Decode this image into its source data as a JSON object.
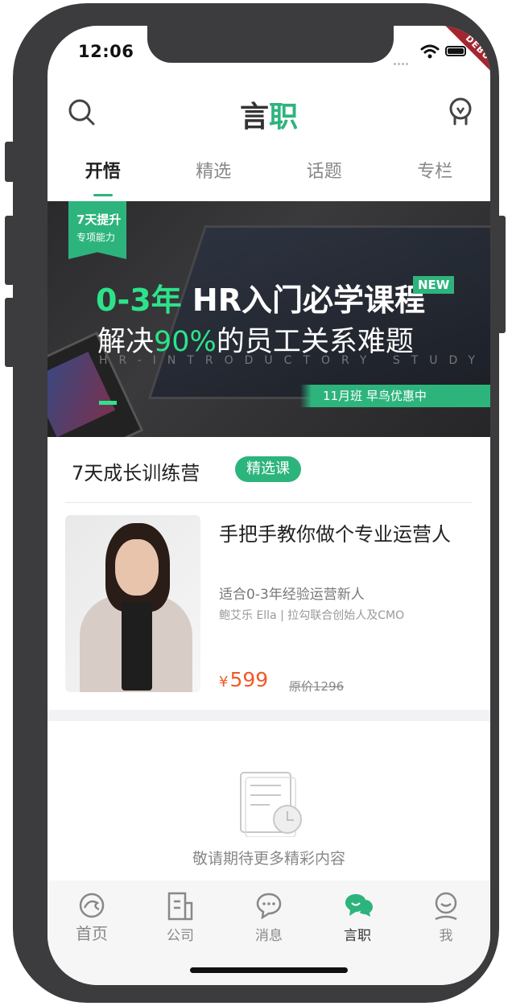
{
  "status_bar": {
    "time": "12:06",
    "debug_label": "DEBUG"
  },
  "header": {
    "title_part1": "言",
    "title_part2": "职"
  },
  "tabs": [
    {
      "label": "开悟",
      "active": true
    },
    {
      "label": "精选",
      "active": false
    },
    {
      "label": "话题",
      "active": false
    },
    {
      "label": "专栏",
      "active": false
    }
  ],
  "banner": {
    "badge_line1": "7天提升",
    "badge_line2": "专项能力",
    "line1_highlight": "0-3年",
    "line1_text": " HR入门必学课程",
    "new_label": "NEW",
    "line2_prefix": "解决",
    "line2_highlight": "90%",
    "line2_suffix": "的员工关系难题",
    "subtitle": "HR-INTRODUCTORY STUDY",
    "promo": "11月班 早鸟优惠中"
  },
  "section": {
    "title": "7天成长训练营",
    "tag": "精选课"
  },
  "course": {
    "title": "手把手教你做个专业运营人",
    "subtitle": "适合0-3年经验运营新人",
    "author": "鲍艾乐 Ella | 拉勾联合创始人及CMO",
    "currency": "¥",
    "price": "599",
    "original_price": "原价1296"
  },
  "empty_state": {
    "text": "敬请期待更多精彩内容"
  },
  "bottom_nav": [
    {
      "label": "首页",
      "icon": "home-icon"
    },
    {
      "label": "公司",
      "icon": "company-icon"
    },
    {
      "label": "消息",
      "icon": "message-icon"
    },
    {
      "label": "言职",
      "icon": "yanzhi-icon",
      "active": true
    },
    {
      "label": "我",
      "icon": "profile-icon"
    }
  ],
  "colors": {
    "accent": "#2db47d",
    "price": "#f05a28",
    "frame": "#3c3c3e"
  }
}
